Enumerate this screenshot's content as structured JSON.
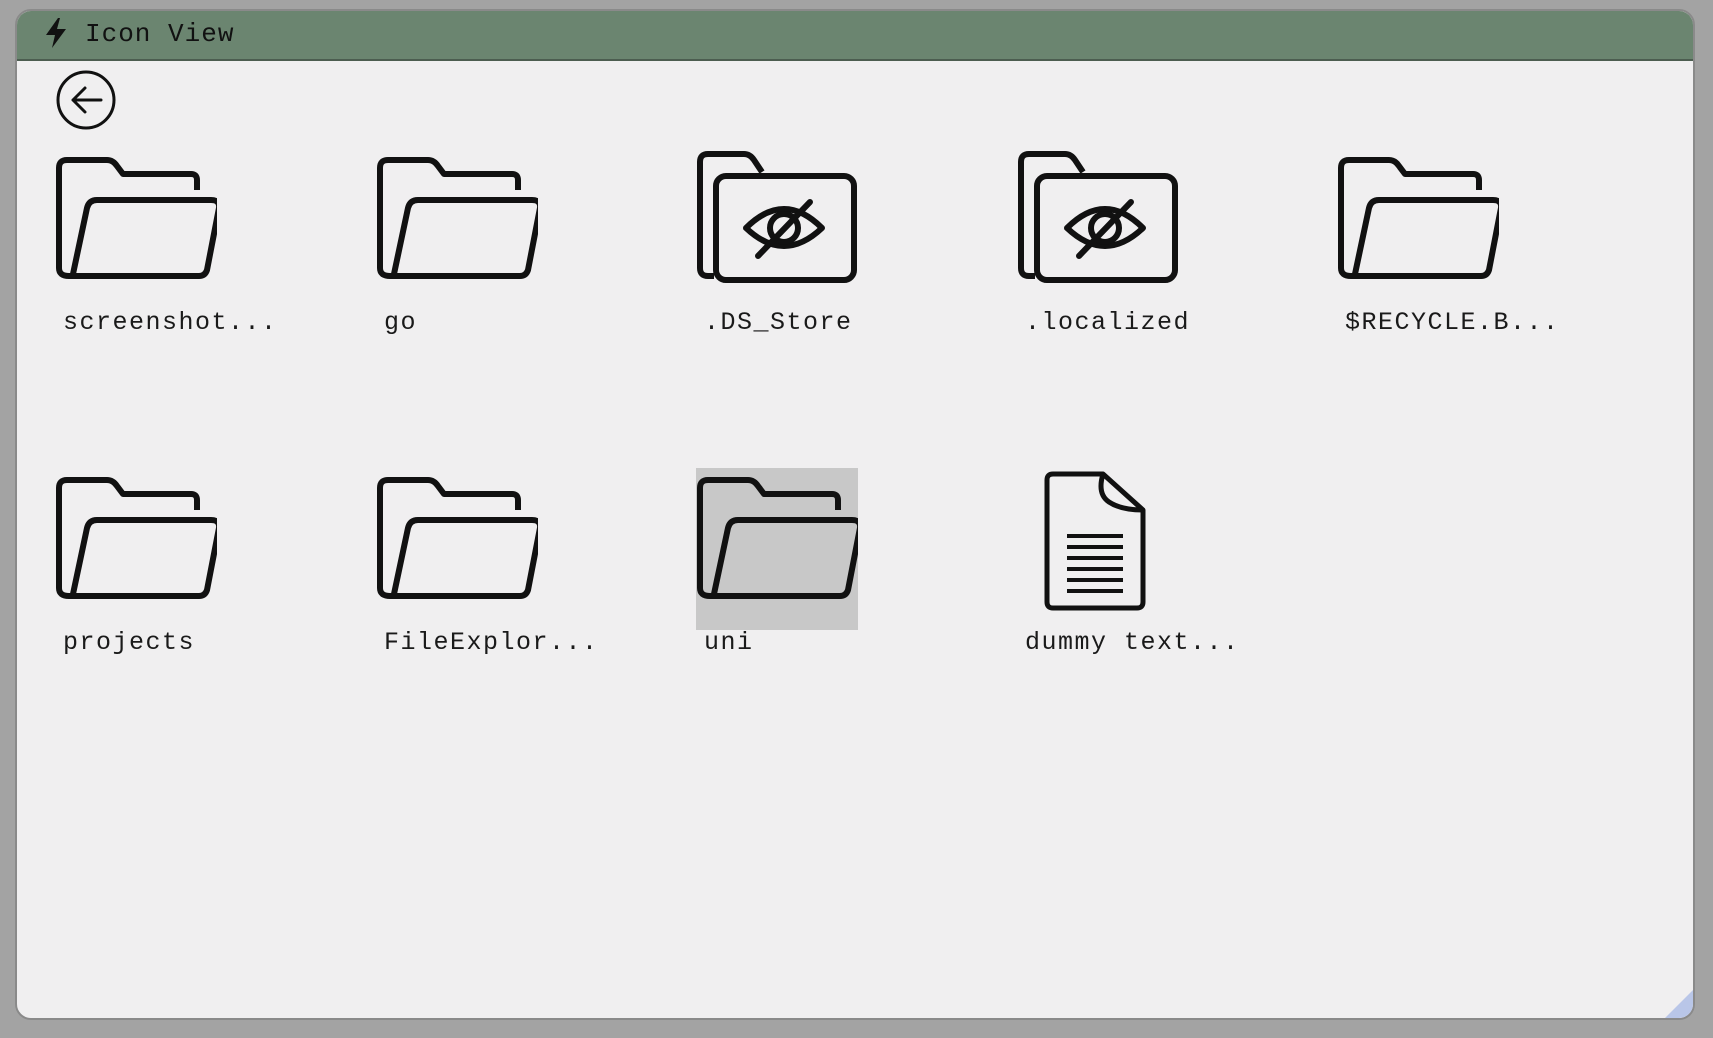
{
  "window": {
    "title": "Icon View"
  },
  "colors": {
    "titlebar": "#6b8570",
    "background": "#f0eff0",
    "selection": "#c8c8c8"
  },
  "toolbar": {
    "back_icon": "arrow-left-circle-icon"
  },
  "items": [
    {
      "label": "screenshot...",
      "icon": "folder-icon"
    },
    {
      "label": "go",
      "icon": "folder-icon"
    },
    {
      "label": ".DS_Store",
      "icon": "hidden-folder-icon"
    },
    {
      "label": ".localized",
      "icon": "hidden-folder-icon"
    },
    {
      "label": "$RECYCLE.B...",
      "icon": "folder-icon"
    },
    {
      "label": "projects",
      "icon": "folder-icon"
    },
    {
      "label": "FileExplor...",
      "icon": "folder-icon"
    },
    {
      "label": "uni",
      "icon": "folder-icon",
      "selected": true
    },
    {
      "label": "dummy text...",
      "icon": "document-icon"
    }
  ]
}
